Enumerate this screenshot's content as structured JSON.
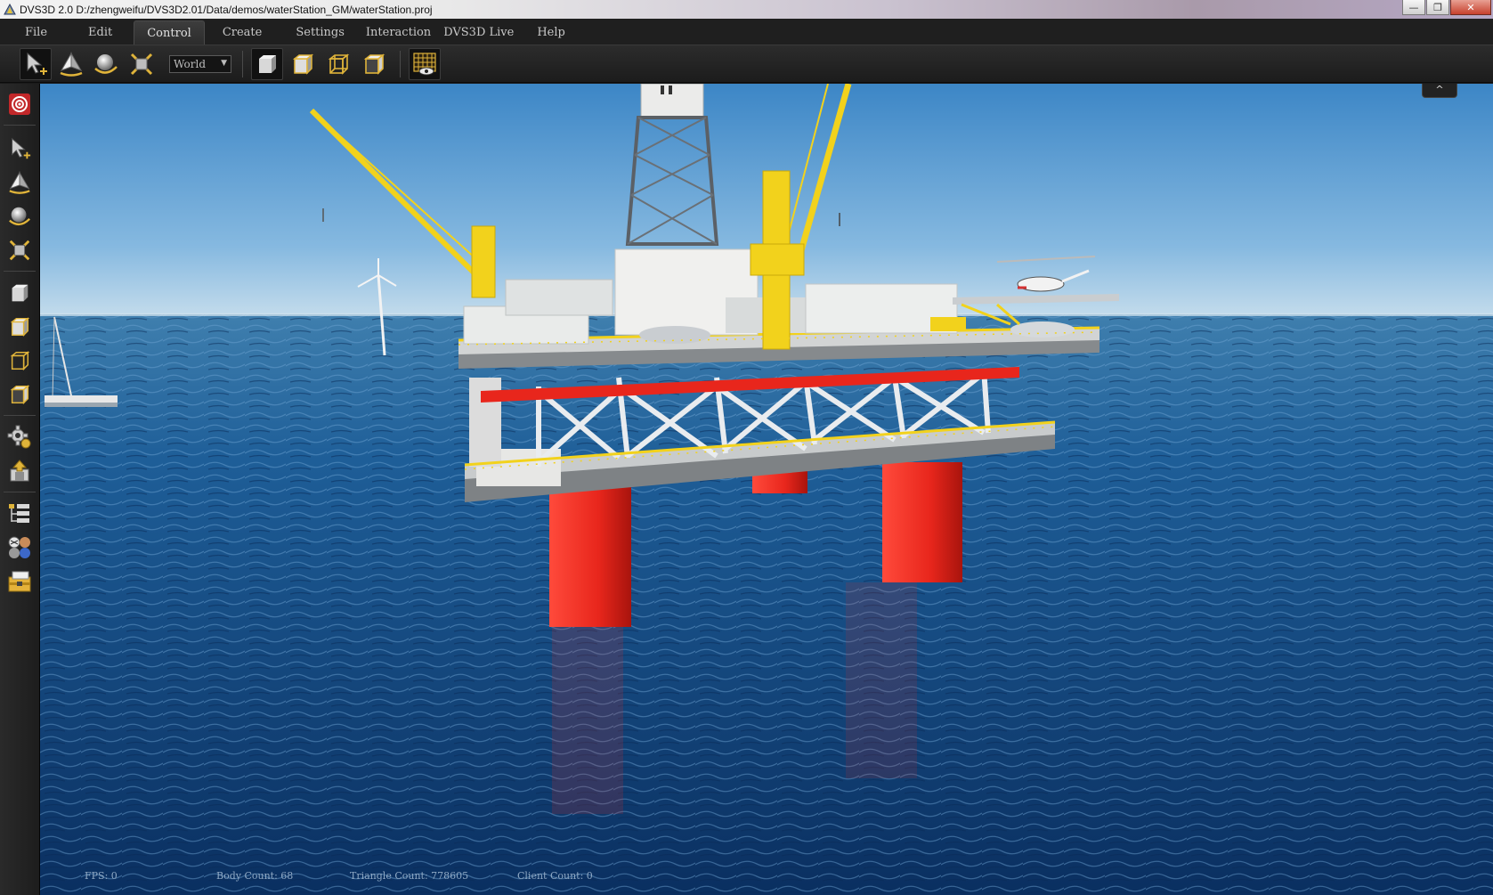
{
  "window": {
    "title": "DVS3D 2.0 D:/zhengweifu/DVS3D2.01/Data/demos/waterStation_GM/waterStation.proj",
    "minimize_glyph": "—",
    "maximize_glyph": "❐",
    "close_glyph": "✕"
  },
  "menu": {
    "items": [
      {
        "label": "File"
      },
      {
        "label": "Edit"
      },
      {
        "label": "Control"
      },
      {
        "label": "Create"
      },
      {
        "label": "Settings"
      },
      {
        "label": "Interaction"
      },
      {
        "label": "DVS3D Live"
      },
      {
        "label": "Help"
      }
    ],
    "active": "Control"
  },
  "toolbar": {
    "coordinate_space": "World",
    "tools": [
      "select-tool-icon",
      "move-tool-icon",
      "rotate-tool-icon",
      "scale-tool-icon"
    ],
    "views": [
      "view-solid-icon",
      "view-shaded-icon",
      "view-wireframe-icon",
      "view-hidden-line-icon"
    ],
    "extra": [
      "grid-visibility-icon"
    ]
  },
  "sidebar": {
    "icons": [
      "target-icon",
      "select-tool-icon",
      "move-tool-icon",
      "rotate-tool-icon",
      "scale-tool-icon",
      "view-solid-icon",
      "view-shaded-icon",
      "view-wireframe-icon",
      "view-hidden-line-icon",
      "settings-gear-icon",
      "export-package-icon",
      "scene-tree-icon",
      "materials-icon",
      "resource-library-icon"
    ]
  },
  "viewport": {
    "collapse_glyph": "^",
    "status": {
      "fps": "FPS: 0",
      "body_count": "Body Count: 68",
      "triangle_count": "Triangle Count: 778605",
      "client_count": "Client Count: 0"
    }
  },
  "colors": {
    "sky_top": "#4f90c8",
    "sky_horizon": "#c2dcec",
    "sea_deep": "#0b3a6e",
    "sea_light": "#2f6ea8",
    "pontoon_red": "#e8261c",
    "crane_yellow": "#f2d21c",
    "deck_white": "#e4e6e6"
  }
}
